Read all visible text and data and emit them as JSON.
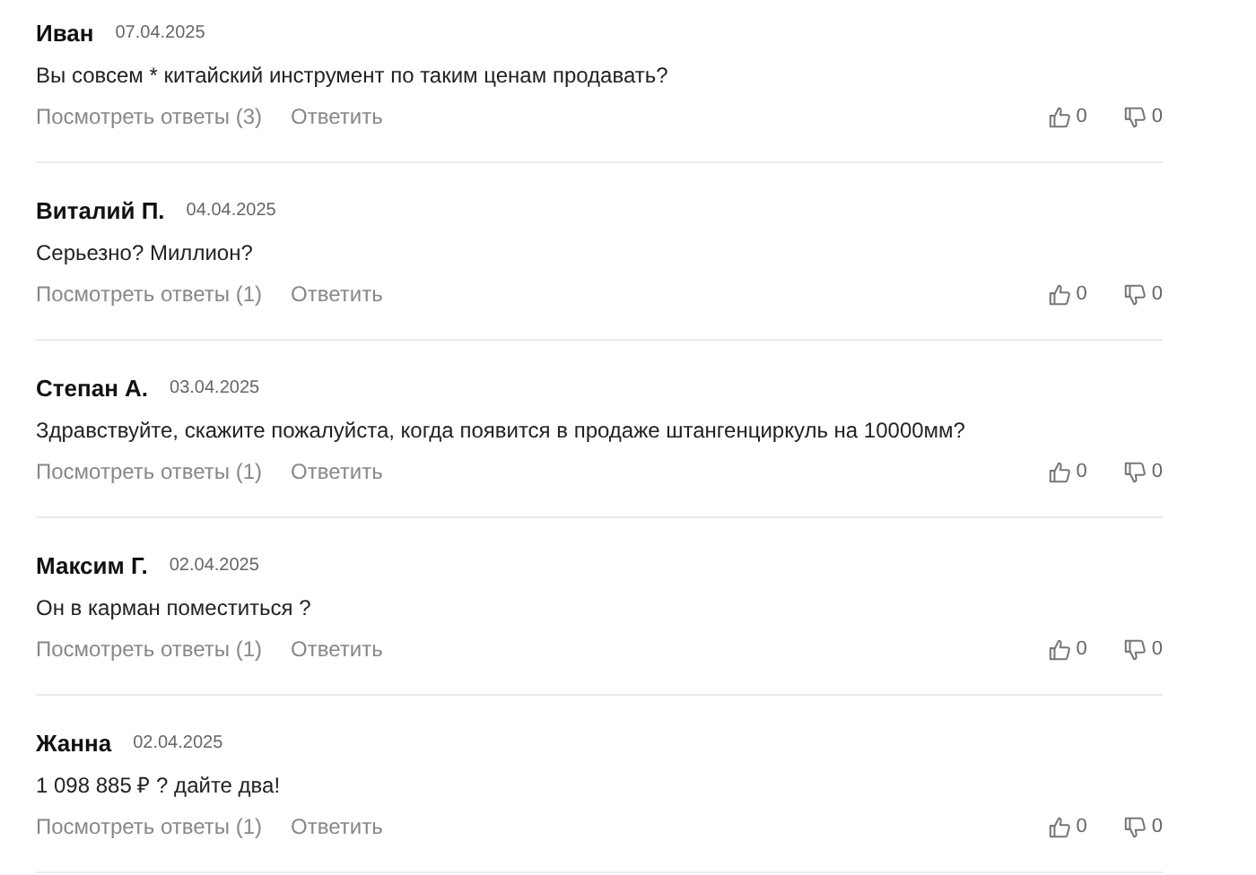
{
  "comments": [
    {
      "author": "Иван",
      "date": "07.04.2025",
      "text": "Вы совсем * китайский инструмент по таким ценам продавать?",
      "replies": "Посмотреть ответы (3)",
      "reply": "Ответить",
      "likes": "0",
      "dislikes": "0"
    },
    {
      "author": "Виталий П.",
      "date": "04.04.2025",
      "text": "Серьезно? Миллион?",
      "replies": "Посмотреть ответы (1)",
      "reply": "Ответить",
      "likes": "0",
      "dislikes": "0"
    },
    {
      "author": "Степан А.",
      "date": "03.04.2025",
      "text": "Здравствуйте, скажите пожалуйста, когда появится в продаже штангенциркуль на 10000мм?",
      "replies": "Посмотреть ответы (1)",
      "reply": "Ответить",
      "likes": "0",
      "dislikes": "0"
    },
    {
      "author": "Максим Г.",
      "date": "02.04.2025",
      "text": "Он в карман поместиться ?",
      "replies": "Посмотреть ответы (1)",
      "reply": "Ответить",
      "likes": "0",
      "dislikes": "0"
    },
    {
      "author": "Жанна",
      "date": "02.04.2025",
      "text": "1 098 885 ₽ ? дайте два!",
      "replies": "Посмотреть ответы (1)",
      "reply": "Ответить",
      "likes": "0",
      "dislikes": "0"
    }
  ]
}
